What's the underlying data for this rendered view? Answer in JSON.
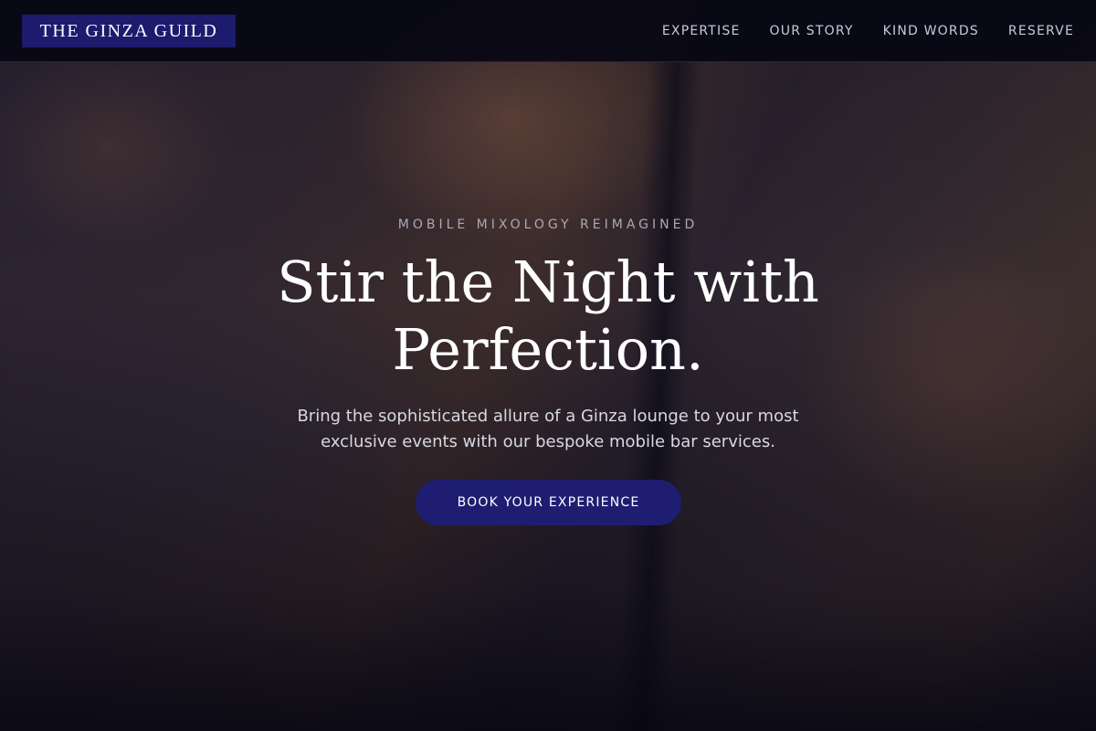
{
  "header": {
    "logo_text": "THE GINZA GUILD",
    "nav": [
      {
        "label": "EXPERTISE"
      },
      {
        "label": "OUR STORY"
      },
      {
        "label": "KIND WORDS"
      },
      {
        "label": "RESERVE"
      }
    ]
  },
  "hero": {
    "eyebrow": "MOBILE MIXOLOGY REIMAGINED",
    "headline_line1": "Stir the Night with",
    "headline_line2": "Perfection.",
    "subtext_line1": "Bring the sophisticated allure of a Ginza lounge to your most",
    "subtext_line2": "exclusive events with our bespoke mobile bar services.",
    "cta_label": "BOOK YOUR EXPERIENCE"
  },
  "colors": {
    "brand": "#1c1b6e",
    "cta": "#1f1d72",
    "header_bg": "#06061a",
    "text_light": "#ffffff"
  }
}
